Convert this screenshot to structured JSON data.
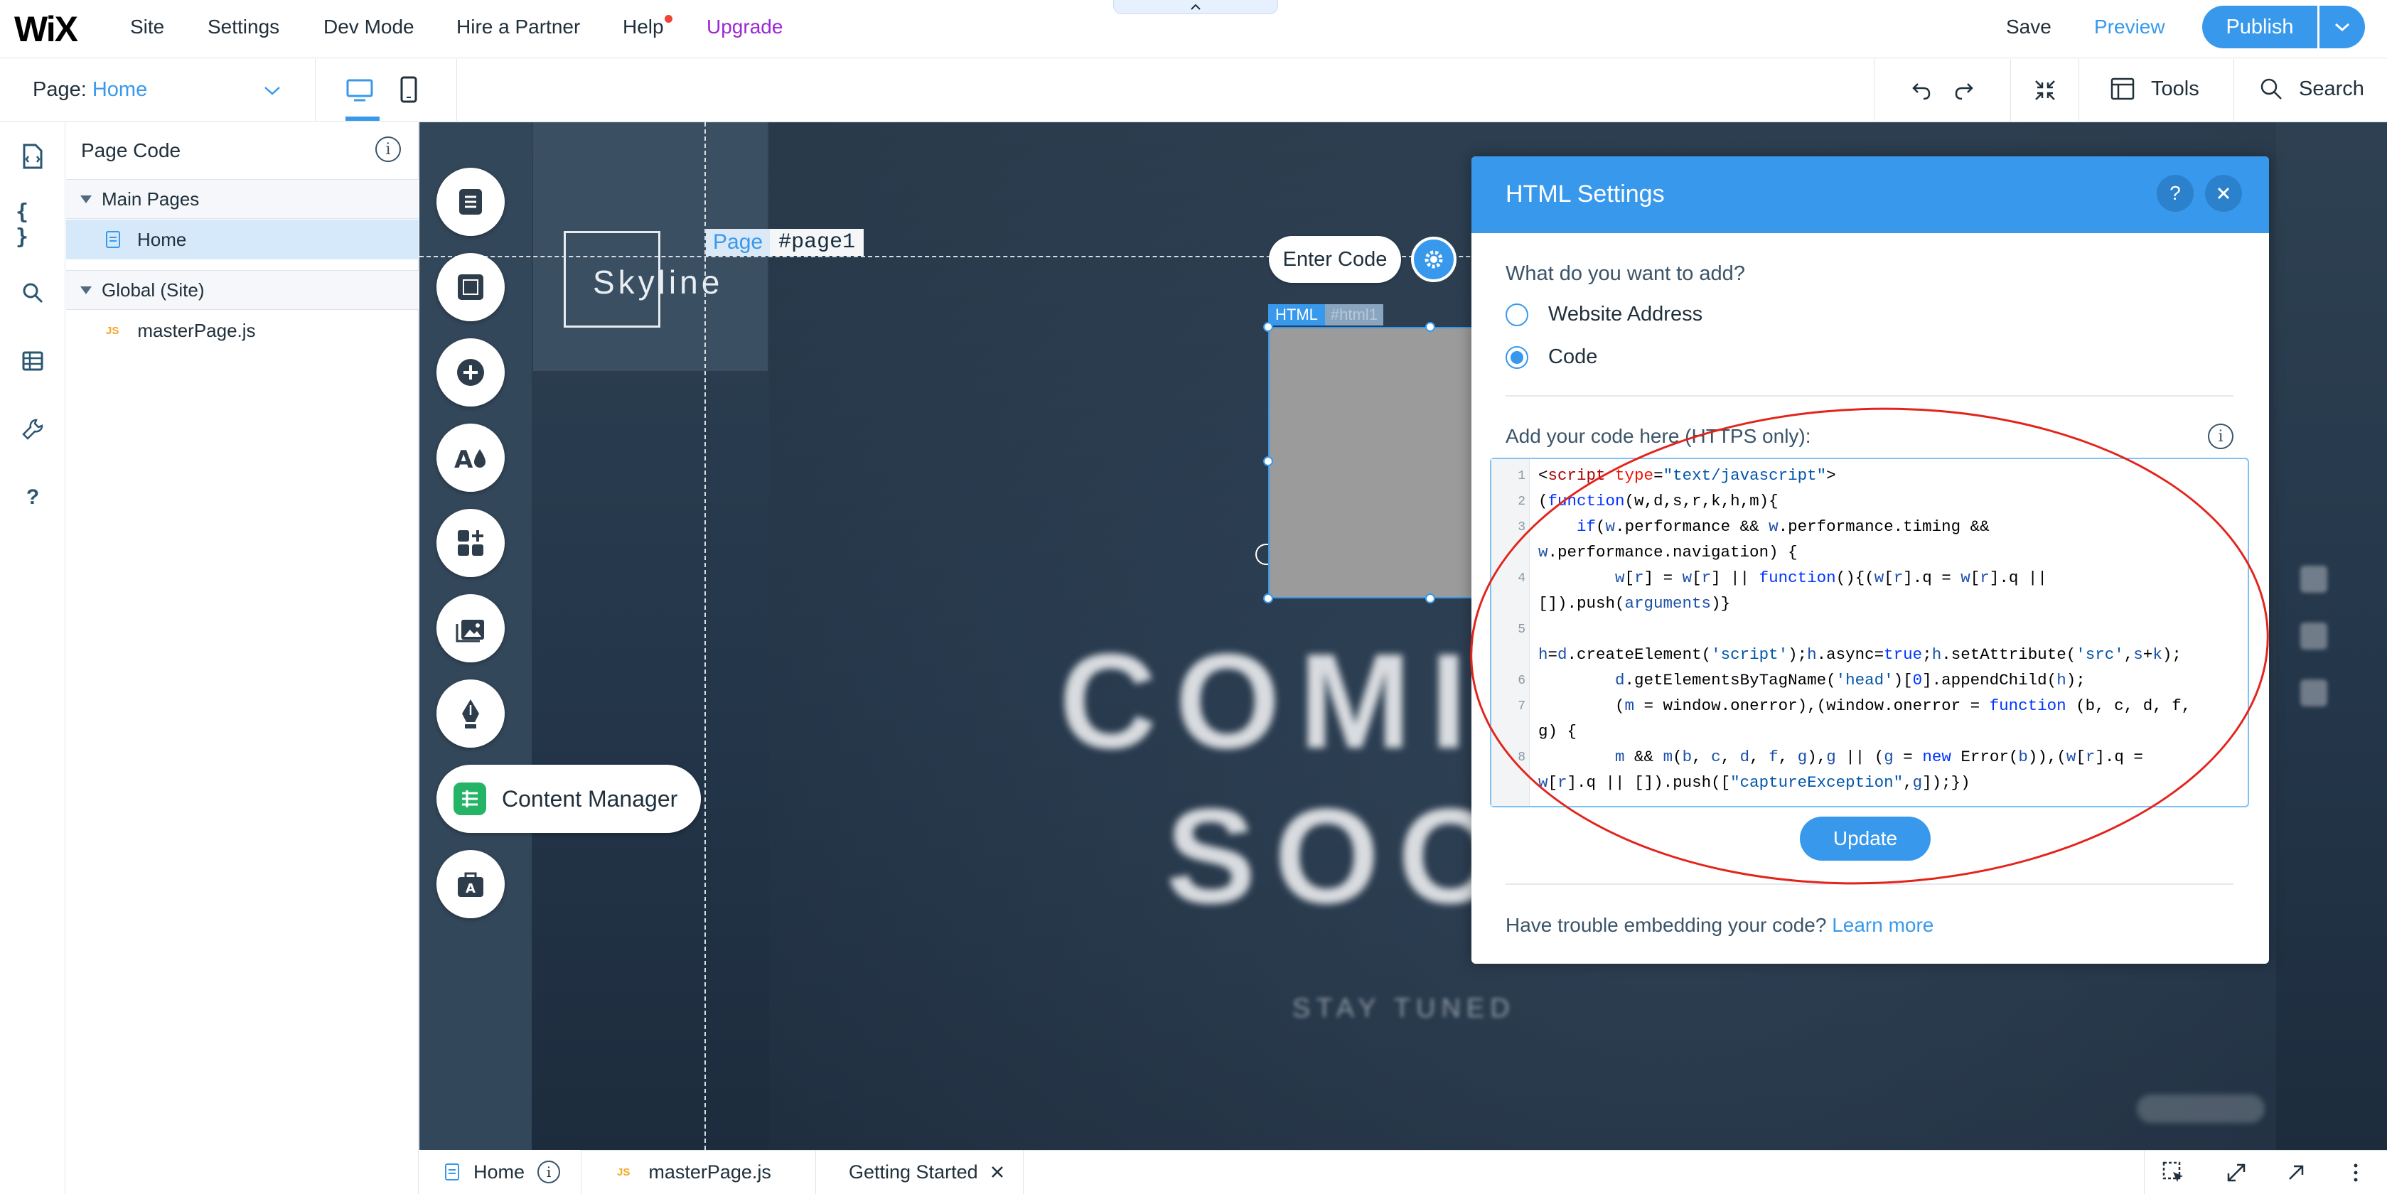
{
  "topbar": {
    "logo": "WiX",
    "menu": [
      "Site",
      "Settings",
      "Dev Mode",
      "Hire a Partner",
      "Help",
      "Upgrade"
    ],
    "save": "Save",
    "preview": "Preview",
    "publish": "Publish"
  },
  "secondbar": {
    "page_label": "Page:",
    "page_value": "Home",
    "tools": "Tools",
    "search": "Search"
  },
  "code_panel": {
    "title": "Page Code",
    "main_pages": "Main Pages",
    "home": "Home",
    "global": "Global (Site)",
    "master_file": "masterPage.js",
    "js_badge": "JS"
  },
  "canvas": {
    "site_logo": "Skyline",
    "page_tag_label": "Page",
    "page_tag_id": "#page1",
    "headline_1": "COMI",
    "headline_2": "SOO",
    "subline": "STAY TUNED",
    "content_manager": "Content Manager",
    "enter_code": "Enter Code",
    "html_tag": "HTML",
    "html_tag_id": "#html1"
  },
  "dialog": {
    "title": "HTML Settings",
    "question": "What do you want to add?",
    "option_website": "Website Address",
    "option_code": "Code",
    "selected": "Code",
    "add_code_label": "Add your code here (HTTPS only):",
    "update": "Update",
    "trouble": "Have trouble embedding your code?",
    "learn_more": "Learn more",
    "line_numbers": [
      "1",
      "2",
      "3",
      "4",
      "5",
      "6",
      "7",
      "8"
    ]
  },
  "bottombar": {
    "tab_home": "Home",
    "tab_master": "masterPage.js",
    "tab_getting_started": "Getting Started"
  },
  "colors": {
    "accent": "#3899ec",
    "upgrade": "#9a27d5",
    "annotation": "#e3241b"
  }
}
